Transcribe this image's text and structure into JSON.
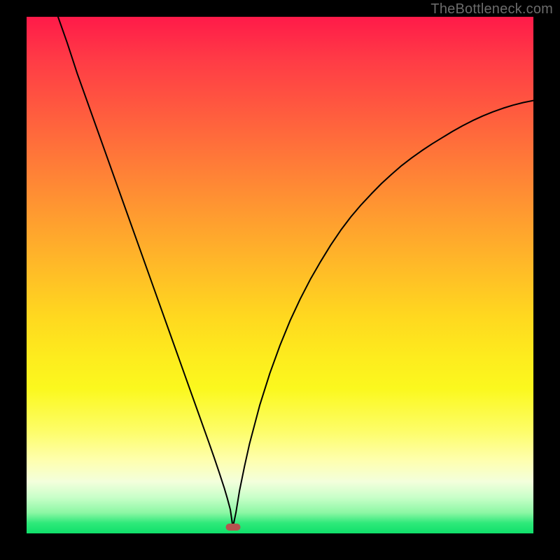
{
  "watermark": "TheBottleneck.com",
  "chart_data": {
    "type": "line",
    "title": "",
    "xlabel": "",
    "ylabel": "",
    "xlim": [
      0,
      100
    ],
    "ylim": [
      0,
      100
    ],
    "grid": false,
    "legend": false,
    "colors": {
      "curve": "#000000",
      "marker": "#b6534f"
    },
    "minimum_marker": {
      "x": 40.7,
      "y": 1.2
    },
    "series": [
      {
        "name": "bottleneck-curve",
        "x": [
          6.2,
          8,
          10,
          12,
          14,
          16,
          18,
          20,
          22,
          24,
          26,
          28,
          30,
          32,
          34,
          36,
          37,
          38,
          39,
          39.6,
          40.2,
          40.7,
          41.3,
          42,
          43,
          44,
          46,
          48,
          50,
          52,
          54,
          56,
          58,
          60,
          62,
          64,
          66,
          68,
          70,
          72,
          74,
          76,
          78,
          80,
          82,
          84,
          86,
          88,
          90,
          92,
          94,
          96,
          98,
          100
        ],
        "y": [
          100,
          95,
          89,
          83.5,
          78,
          72.5,
          67,
          61.5,
          56,
          50.5,
          45,
          39.5,
          34,
          28.5,
          23,
          17.5,
          14.7,
          11.8,
          8.8,
          6.8,
          4.6,
          1.2,
          4.0,
          8.2,
          13.0,
          17.4,
          24.8,
          31.0,
          36.4,
          41.2,
          45.4,
          49.2,
          52.6,
          55.8,
          58.7,
          61.3,
          63.6,
          65.7,
          67.7,
          69.5,
          71.2,
          72.7,
          74.1,
          75.4,
          76.6,
          77.8,
          78.9,
          79.9,
          80.8,
          81.6,
          82.3,
          82.9,
          83.4,
          83.8
        ]
      }
    ]
  }
}
